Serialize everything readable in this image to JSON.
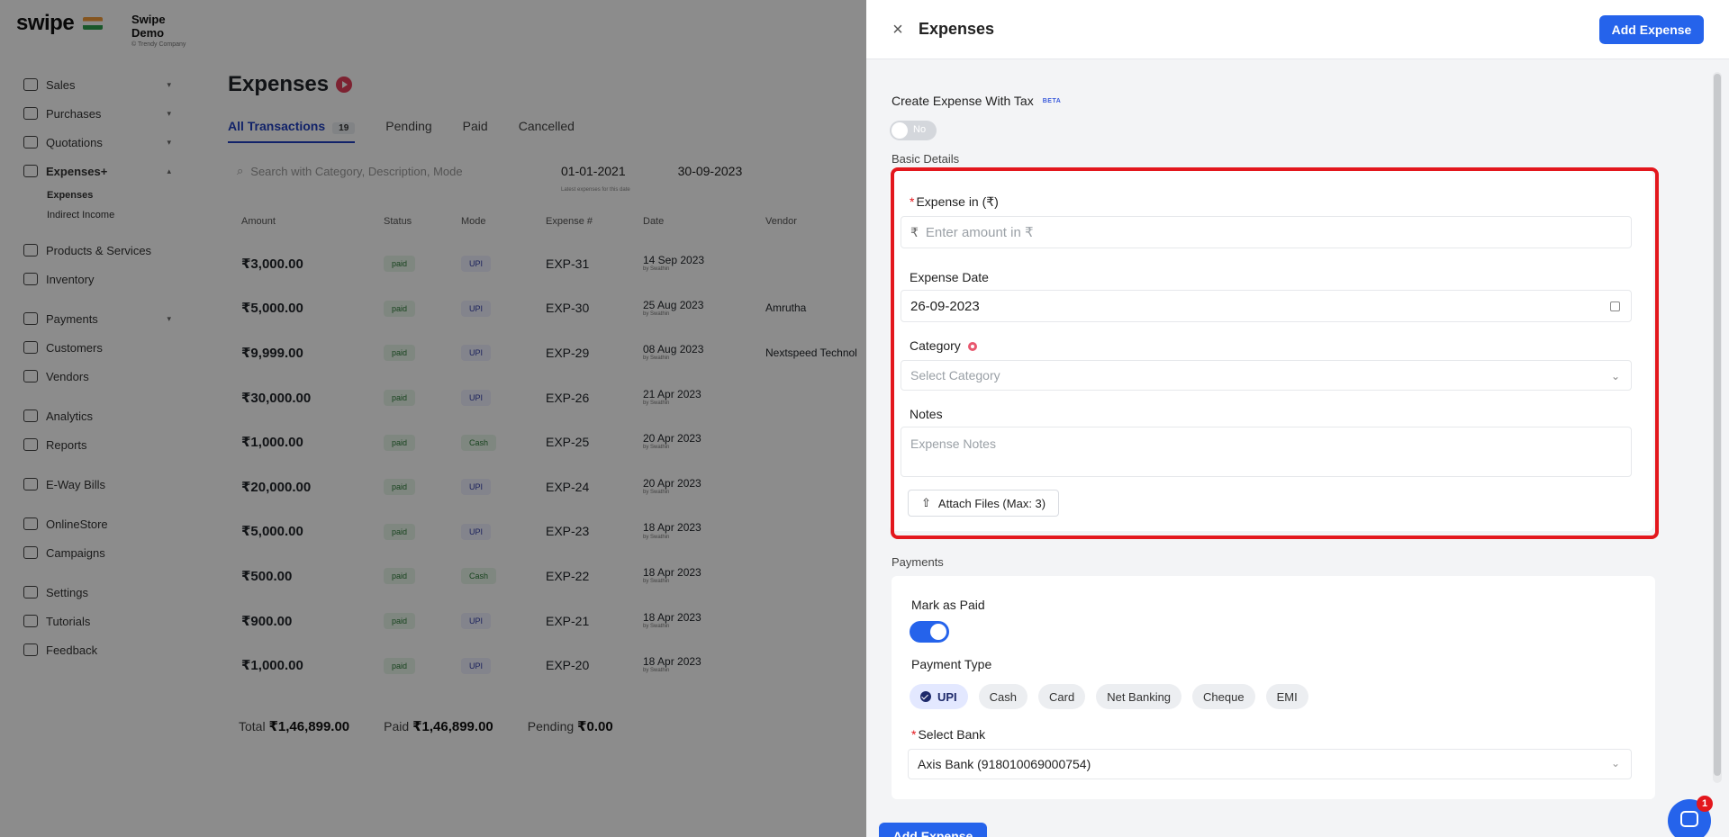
{
  "background": {
    "brand": "swipe",
    "company_name": "Swipe Demo",
    "company_sub": "© Trendy Company",
    "nav": {
      "sales": "Sales",
      "purchases": "Purchases",
      "quotations": "Quotations",
      "expenses": "Expenses+",
      "expenses_sub": "Expenses",
      "indirect_income": "Indirect Income",
      "products": "Products & Services",
      "inventory": "Inventory",
      "payments": "Payments",
      "customers": "Customers",
      "vendors": "Vendors",
      "analytics": "Analytics",
      "reports": "Reports",
      "eway": "E-Way Bills",
      "onlinestore": "OnlineStore",
      "campaigns": "Campaigns",
      "settings": "Settings",
      "tutorials": "Tutorials",
      "feedback": "Feedback"
    },
    "page_title": "Expenses",
    "tabs": {
      "all": "All Transactions",
      "all_count": "19",
      "pending": "Pending",
      "paid": "Paid",
      "cancelled": "Cancelled"
    },
    "search_placeholder": "Search with Category, Description, Mode",
    "date_from": "01-01-2021",
    "date_to": "30-09-2023",
    "date_hint": "Latest expenses for this date",
    "columns": [
      "Amount",
      "Status",
      "Mode",
      "Expense #",
      "Date",
      "Vendor"
    ],
    "rows": [
      {
        "amount": "₹3,000.00",
        "status": "paid",
        "mode": "UPI",
        "expense": "EXP-31",
        "date": "14 Sep 2023",
        "by": "by Swathin",
        "vendor": ""
      },
      {
        "amount": "₹5,000.00",
        "status": "paid",
        "mode": "UPI",
        "expense": "EXP-30",
        "date": "25 Aug 2023",
        "by": "by Swathin",
        "vendor": "Amrutha"
      },
      {
        "amount": "₹9,999.00",
        "status": "paid",
        "mode": "UPI",
        "expense": "EXP-29",
        "date": "08 Aug 2023",
        "by": "by Swathin",
        "vendor": "Nextspeed Technol"
      },
      {
        "amount": "₹30,000.00",
        "status": "paid",
        "mode": "UPI",
        "expense": "EXP-26",
        "date": "21 Apr 2023",
        "by": "by Swathin",
        "vendor": ""
      },
      {
        "amount": "₹1,000.00",
        "status": "paid",
        "mode": "Cash",
        "expense": "EXP-25",
        "date": "20 Apr 2023",
        "by": "by Swathin",
        "vendor": ""
      },
      {
        "amount": "₹20,000.00",
        "status": "paid",
        "mode": "UPI",
        "expense": "EXP-24",
        "date": "20 Apr 2023",
        "by": "by Swathin",
        "vendor": ""
      },
      {
        "amount": "₹5,000.00",
        "status": "paid",
        "mode": "UPI",
        "expense": "EXP-23",
        "date": "18 Apr 2023",
        "by": "by Swathin",
        "vendor": ""
      },
      {
        "amount": "₹500.00",
        "status": "paid",
        "mode": "Cash",
        "expense": "EXP-22",
        "date": "18 Apr 2023",
        "by": "by Swathin",
        "vendor": ""
      },
      {
        "amount": "₹900.00",
        "status": "paid",
        "mode": "UPI",
        "expense": "EXP-21",
        "date": "18 Apr 2023",
        "by": "by Swathin",
        "vendor": ""
      },
      {
        "amount": "₹1,000.00",
        "status": "paid",
        "mode": "UPI",
        "expense": "EXP-20",
        "date": "18 Apr 2023",
        "by": "by Swathin",
        "vendor": ""
      }
    ],
    "totals": {
      "total_label": "Total",
      "total_value": "₹1,46,899.00",
      "paid_label": "Paid",
      "paid_value": "₹1,46,899.00",
      "pending_label": "Pending",
      "pending_value": "₹0.00"
    }
  },
  "drawer": {
    "title": "Expenses",
    "close_icon": "×",
    "add_button": "Add Expense",
    "tax_label": "Create Expense With Tax",
    "beta": "BETA",
    "tax_toggle": "No",
    "basic_details": "Basic Details",
    "expense_label": "Expense in (₹)",
    "rupee": "₹",
    "amount_placeholder": "Enter amount in ₹",
    "date_label": "Expense Date",
    "date_value": "26-09-2023",
    "category_label": "Category",
    "category_placeholder": "Select Category",
    "notes_label": "Notes",
    "notes_placeholder": "Expense Notes",
    "attach_label": "Attach Files (Max: 3)",
    "payments": "Payments",
    "mark_paid": "Mark as Paid",
    "payment_type": "Payment Type",
    "payment_types": [
      "UPI",
      "Cash",
      "Card",
      "Net Banking",
      "Cheque",
      "EMI"
    ],
    "select_bank_label": "Select Bank",
    "bank_value": "Axis Bank (918010069000754)",
    "footer_add": "Add Expense",
    "chat_badge": "1",
    "accent": "#2563eb",
    "highlight_color": "#e3171d"
  }
}
